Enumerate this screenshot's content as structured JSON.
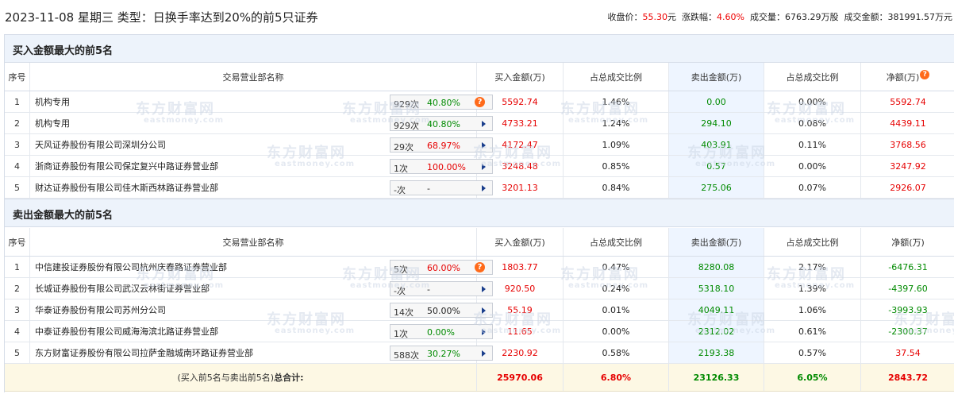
{
  "header": {
    "title": "2023-11-08 星期三 类型：日换手率达到20%的前5只证券",
    "close_label": "收盘价：",
    "close_value": "55.30",
    "close_unit": "元",
    "change_label": "涨跌幅：",
    "change_value": "4.60%",
    "volume_label": "成交量：",
    "volume_value": "6763.29万股",
    "amount_label": "成交金额：",
    "amount_value": "381991.57万元"
  },
  "columns": {
    "index": "序号",
    "dept": "交易营业部名称",
    "buy": "买入金额(万)",
    "buy_ratio": "占总成交比例",
    "sell": "卖出金额(万)",
    "sell_ratio": "占总成交比例",
    "net": "净额(万)",
    "net_help": "?"
  },
  "buy_section": {
    "title": "买入金额最大的前5名",
    "rows": [
      {
        "idx": "1",
        "name": "机构专用",
        "count": "929次",
        "rate": "40.80%",
        "rate_color": "green",
        "marker": "question",
        "buy": "5592.74",
        "buy_ratio": "1.46%",
        "sell": "0.00",
        "sell_ratio": "0.00%",
        "net": "5592.74",
        "net_color": "red"
      },
      {
        "idx": "2",
        "name": "机构专用",
        "count": "929次",
        "rate": "40.80%",
        "rate_color": "green",
        "marker": "arrow",
        "buy": "4733.21",
        "buy_ratio": "1.24%",
        "sell": "294.10",
        "sell_ratio": "0.08%",
        "net": "4439.11",
        "net_color": "red"
      },
      {
        "idx": "3",
        "name": "天风证券股份有限公司深圳分公司",
        "count": "29次",
        "rate": "68.97%",
        "rate_color": "red",
        "marker": "arrow",
        "buy": "4172.47",
        "buy_ratio": "1.09%",
        "sell": "403.91",
        "sell_ratio": "0.11%",
        "net": "3768.56",
        "net_color": "red"
      },
      {
        "idx": "4",
        "name": "浙商证券股份有限公司保定复兴中路证券营业部",
        "count": "1次",
        "rate": "100.00%",
        "rate_color": "red",
        "marker": "arrow",
        "buy": "3248.48",
        "buy_ratio": "0.85%",
        "sell": "0.57",
        "sell_ratio": "0.00%",
        "net": "3247.92",
        "net_color": "red"
      },
      {
        "idx": "5",
        "name": "财达证券股份有限公司佳木斯西林路证券营业部",
        "count": "-次",
        "rate": "-",
        "rate_color": "dark",
        "marker": "arrow",
        "buy": "3201.13",
        "buy_ratio": "0.84%",
        "sell": "275.06",
        "sell_ratio": "0.07%",
        "net": "2926.07",
        "net_color": "red"
      }
    ]
  },
  "sell_section": {
    "title": "卖出金额最大的前5名",
    "rows": [
      {
        "idx": "1",
        "name": "中信建投证券股份有限公司杭州庆春路证券营业部",
        "count": "5次",
        "rate": "60.00%",
        "rate_color": "red",
        "marker": "question",
        "buy": "1803.77",
        "buy_ratio": "0.47%",
        "sell": "8280.08",
        "sell_ratio": "2.17%",
        "net": "-6476.31",
        "net_color": "green"
      },
      {
        "idx": "2",
        "name": "长城证券股份有限公司武汉云林街证券营业部",
        "count": "-次",
        "rate": "-",
        "rate_color": "dark",
        "marker": "arrow",
        "buy": "920.50",
        "buy_ratio": "0.24%",
        "sell": "5318.10",
        "sell_ratio": "1.39%",
        "net": "-4397.60",
        "net_color": "green"
      },
      {
        "idx": "3",
        "name": "华泰证券股份有限公司苏州分公司",
        "count": "14次",
        "rate": "50.00%",
        "rate_color": "dark",
        "marker": "arrow",
        "buy": "55.19",
        "buy_ratio": "0.01%",
        "sell": "4049.11",
        "sell_ratio": "1.06%",
        "net": "-3993.93",
        "net_color": "green"
      },
      {
        "idx": "4",
        "name": "中泰证券股份有限公司威海海滨北路证券营业部",
        "count": "1次",
        "rate": "0.00%",
        "rate_color": "green",
        "marker": "arrow",
        "buy": "11.65",
        "buy_ratio": "0.00%",
        "sell": "2312.02",
        "sell_ratio": "0.61%",
        "net": "-2300.37",
        "net_color": "green"
      },
      {
        "idx": "5",
        "name": "东方财富证券股份有限公司拉萨金融城南环路证券营业部",
        "count": "588次",
        "rate": "30.27%",
        "rate_color": "green",
        "marker": "arrow",
        "buy": "2230.92",
        "buy_ratio": "0.58%",
        "sell": "2193.38",
        "sell_ratio": "0.57%",
        "net": "37.54",
        "net_color": "red"
      }
    ]
  },
  "total": {
    "label_prefix": "(买入前5名与卖出前5名)",
    "label_bold": "总合计:",
    "buy": "25970.06",
    "buy_ratio": "6.80%",
    "sell": "23126.33",
    "sell_ratio": "6.05%",
    "net": "2843.72"
  },
  "watermark": {
    "cn": "东方财富网",
    "en": "eastmoney.com"
  },
  "colors": {
    "red": "#e60000",
    "green": "#008a00",
    "header_bg": "#edf3fb",
    "total_bg": "#fdf8e4",
    "sell_col_bg": "#eef5ff",
    "help_icon": "#ff6a1a"
  }
}
